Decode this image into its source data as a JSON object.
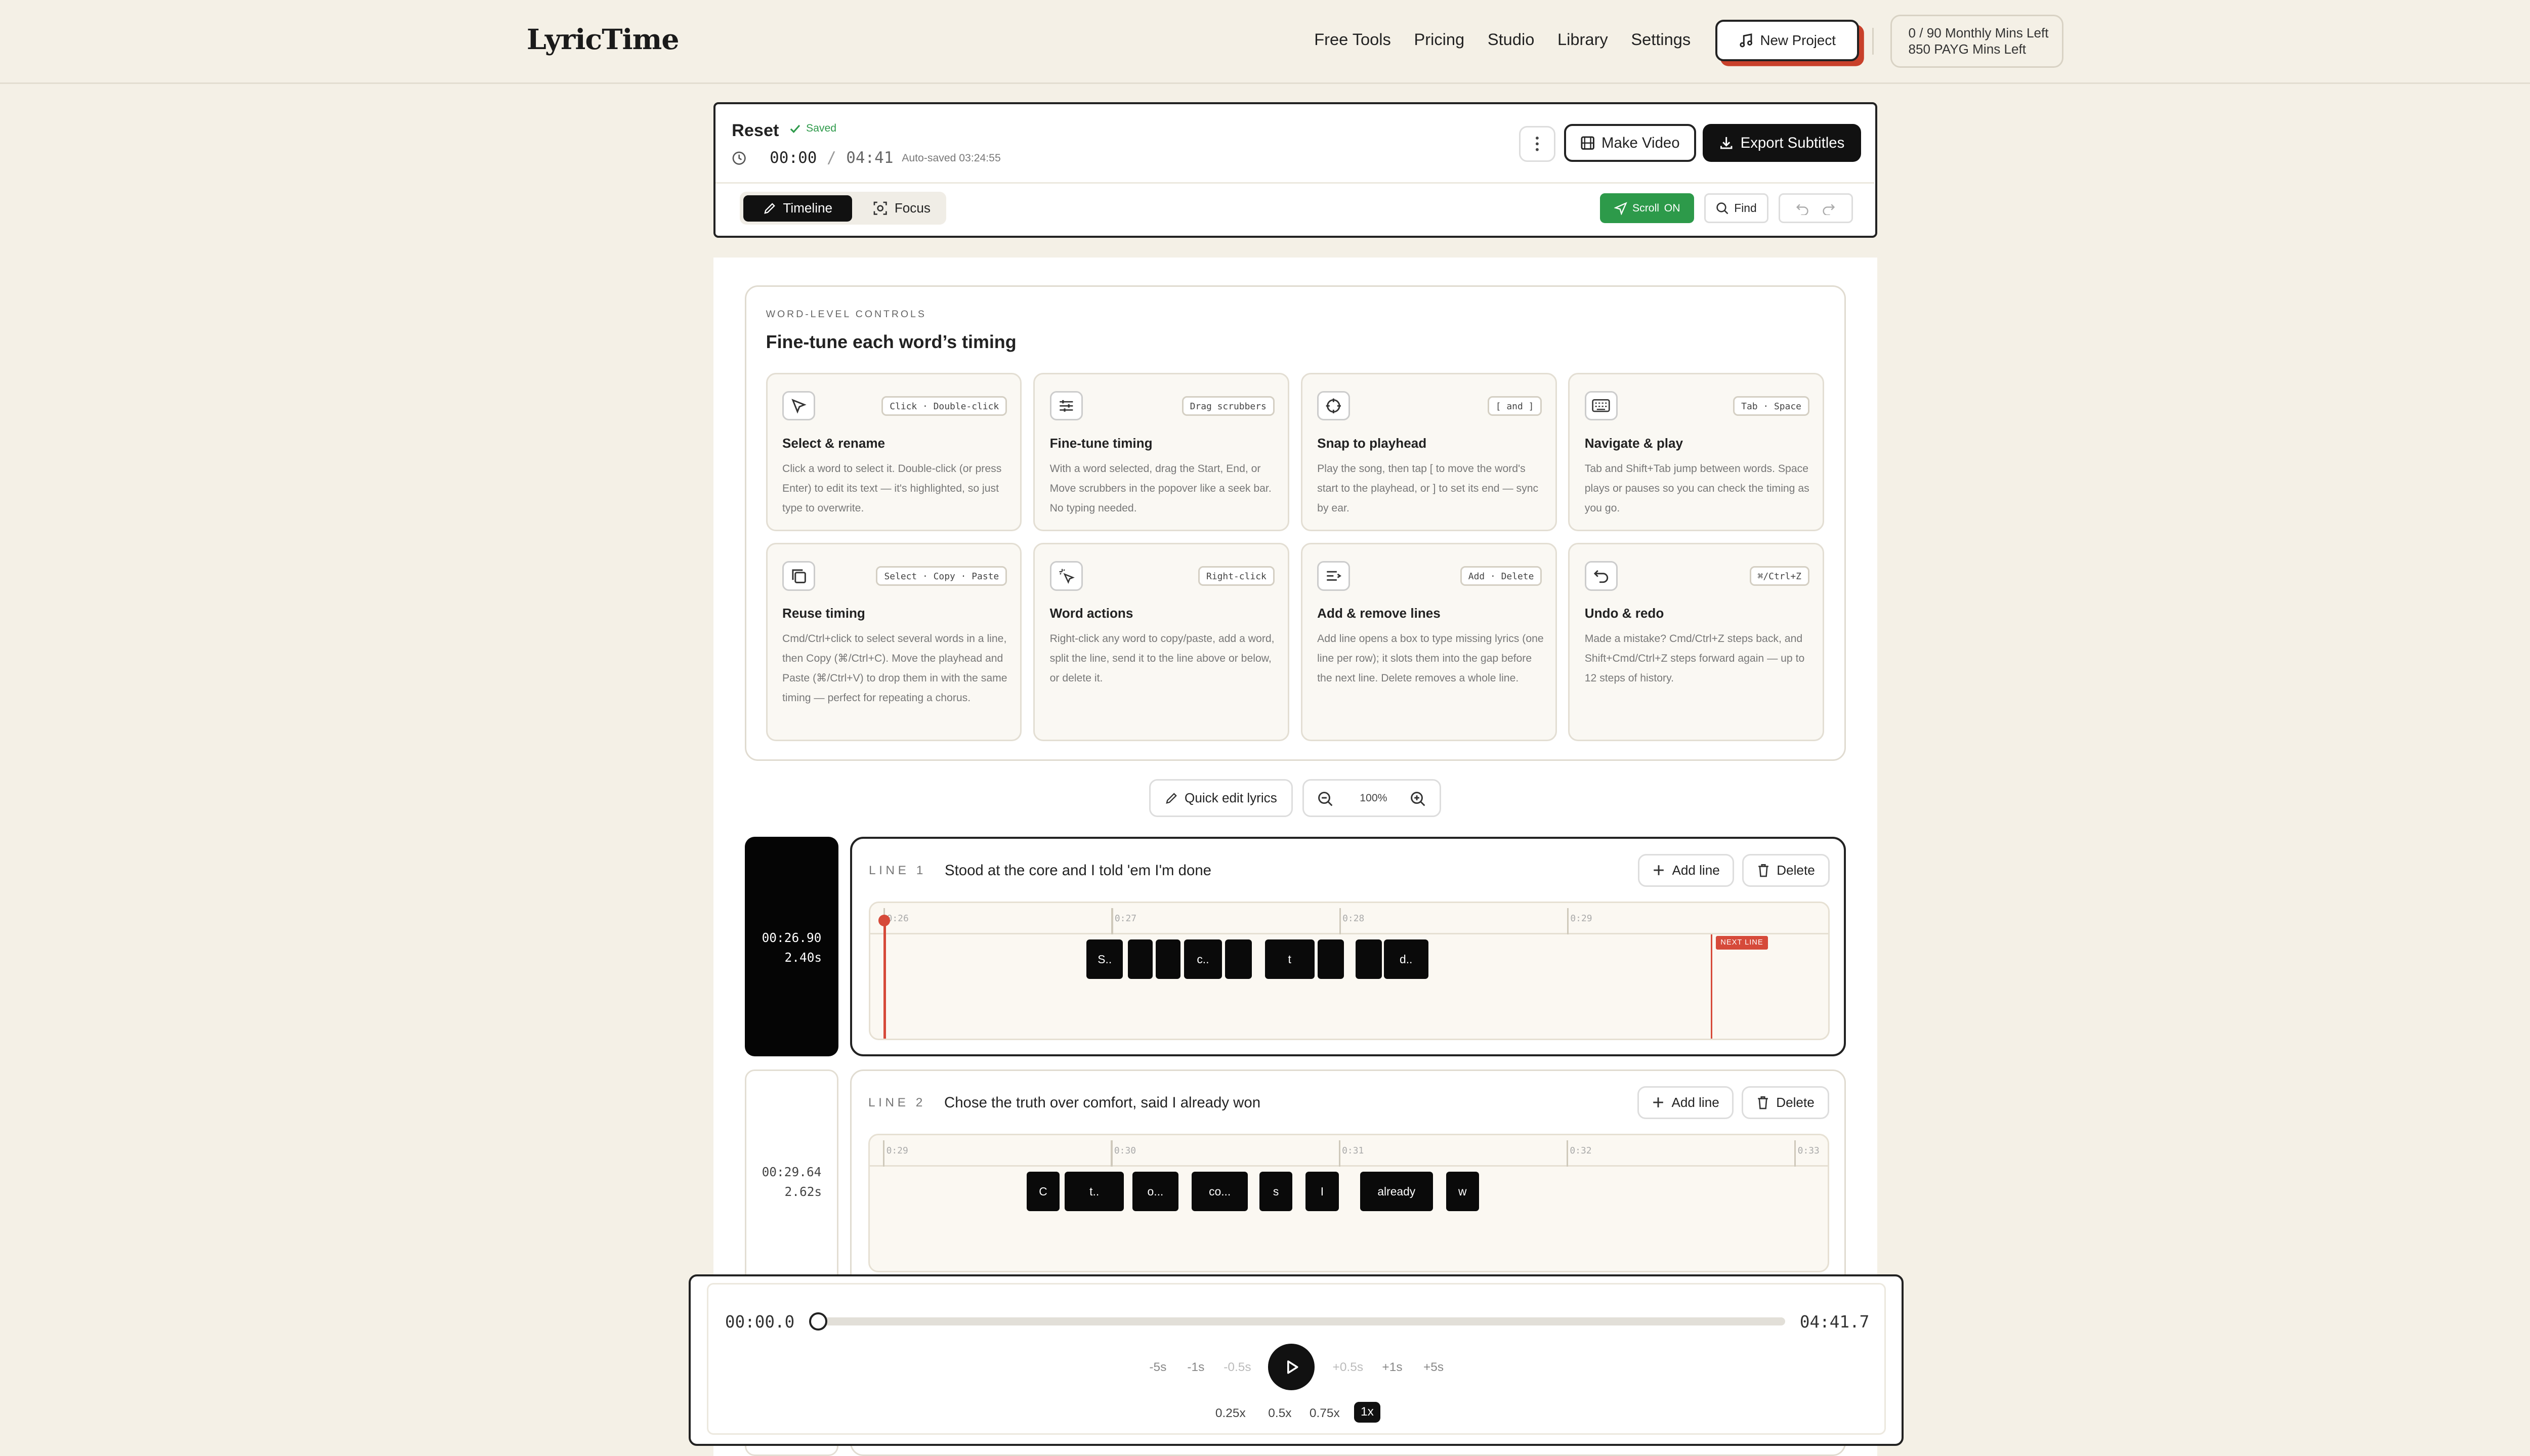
{
  "nav": {
    "logo": "LyricTime",
    "links": [
      "Free Tools",
      "Pricing",
      "Studio",
      "Library",
      "Settings"
    ],
    "new_project": "New Project",
    "monthly_mins": "0 / 90 Monthly Mins Left",
    "payg_mins": "850 PAYG Mins Left"
  },
  "project": {
    "title": "Reset",
    "saved_label": "Saved",
    "current_time": "00:00",
    "separator": "/",
    "duration": "04:41",
    "autosaved": "Auto-saved 03:24:55",
    "make_video": "Make Video",
    "export_subtitles": "Export Subtitles",
    "modes": [
      "Timeline",
      "Focus"
    ],
    "scroll_label": "Scroll",
    "scroll_state": "ON",
    "find_label": "Find"
  },
  "controls": {
    "eyebrow": "WORD-LEVEL CONTROLS",
    "title": "Fine-tune each word’s timing",
    "tiles": [
      {
        "icon": "cursor-icon",
        "key": "Click · Double-click",
        "title": "Select & rename",
        "desc": "Click a word to select it. Double-click (or press Enter) to edit its text — it's highlighted, so just type to overwrite."
      },
      {
        "icon": "sliders-icon",
        "key": "Drag scrubbers",
        "title": "Fine-tune timing",
        "desc": "With a word selected, drag the Start, End, or Move scrubbers in the popover like a seek bar. No typing needed."
      },
      {
        "icon": "crosshair-icon",
        "key": "[ and ]",
        "title": "Snap to playhead",
        "desc": "Play the song, then tap [ to move the word's start to the playhead, or ] to set its end — sync by ear."
      },
      {
        "icon": "keyboard-icon",
        "key": "Tab · Space",
        "title": "Navigate & play",
        "desc": "Tab and Shift+Tab jump between words. Space plays or pauses so you can check the timing as you go."
      },
      {
        "icon": "copy-icon",
        "key": "Select · Copy · Paste",
        "title": "Reuse timing",
        "desc": "Cmd/Ctrl+click to select several words in a line, then Copy (⌘/Ctrl+C). Move the playhead and Paste (⌘/Ctrl+V) to drop them in with the same timing — perfect for repeating a chorus."
      },
      {
        "icon": "sparkle-cursor-icon",
        "key": "Right-click",
        "title": "Word actions",
        "desc": "Right-click any word to copy/paste, add a word, split the line, send it to the line above or below, or delete it."
      },
      {
        "icon": "list-add-icon",
        "key": "Add · Delete",
        "title": "Add & remove lines",
        "desc": "Add line opens a box to type missing lyrics (one line per row); it slots them into the gap before the next line. Delete removes a whole line."
      },
      {
        "icon": "undo-icon",
        "key": "⌘/Ctrl+Z",
        "title": "Undo & redo",
        "desc": "Made a mistake? Cmd/Ctrl+Z steps back, and Shift+Cmd/Ctrl+Z steps forward again — up to 12 steps of history."
      }
    ]
  },
  "toolbar": {
    "quick_edit": "Quick edit lyrics",
    "zoom": "100%"
  },
  "lines": [
    {
      "label": "LINE 1",
      "text": "Stood at the core and I told 'em I'm done",
      "start": "00:26.90",
      "length": "2.40s",
      "ticks": [
        "0:26",
        "0:27",
        "0:28",
        "0:29"
      ],
      "words": [
        "S..",
        "",
        "",
        "c..",
        "",
        "t",
        "",
        "",
        "d.."
      ],
      "next_line": "NEXT LINE",
      "add_line": "Add line",
      "delete": "Delete"
    },
    {
      "label": "LINE 2",
      "text": "Chose the truth over comfort, said I already won",
      "start": "00:29.64",
      "length": "2.62s",
      "ticks": [
        "0:29",
        "0:30",
        "0:31",
        "0:32",
        "0:33"
      ],
      "words": [
        "C",
        "t..",
        "o...",
        "co...",
        "s",
        "I",
        "already",
        "w"
      ],
      "add_line": "Add line",
      "delete": "Delete"
    }
  ],
  "player": {
    "current": "00:00.0",
    "total": "04:41.7",
    "progress": 0,
    "skips": [
      "-5s",
      "-1s",
      "-0.5s",
      "+0.5s",
      "+1s",
      "+5s"
    ],
    "rates": [
      "0.25x",
      "0.5x",
      "0.75x",
      "1x"
    ],
    "selected_rate": "1x"
  }
}
